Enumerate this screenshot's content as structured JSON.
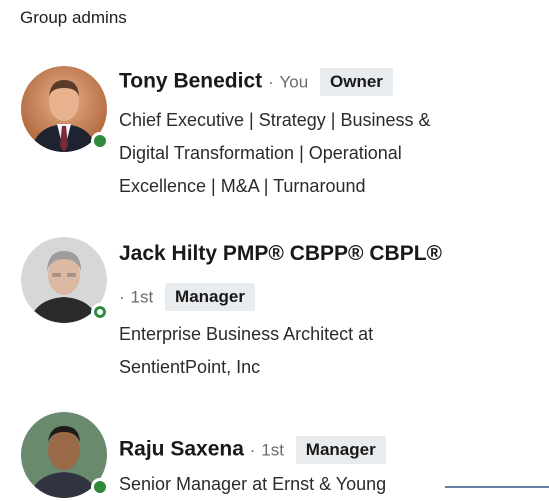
{
  "section": {
    "title": "Group admins"
  },
  "admins": [
    {
      "name": "Tony Benedict",
      "separator": "·",
      "relation": "You",
      "role": "Owner",
      "headline_lines": [
        "Chief Executive | Strategy | Business &",
        "Digital Transformation | Operational",
        "Excellence | M&A | Turnaround"
      ],
      "presence": "online"
    },
    {
      "name": "Jack Hilty PMP® CBPP® CBPL®",
      "separator": "·",
      "relation": "1st",
      "role": "Manager",
      "headline_lines": [
        "Enterprise Business Architect at",
        "SentientPoint, Inc"
      ],
      "presence": "away"
    },
    {
      "name": "Raju Saxena",
      "separator": "·",
      "relation": "1st",
      "role": "Manager",
      "headline_lines": [
        "Senior Manager at Ernst & Young"
      ],
      "presence": "online"
    }
  ],
  "colors": {
    "presence_green": "#2f8a3a",
    "badge_bg": "#e9ecef"
  }
}
